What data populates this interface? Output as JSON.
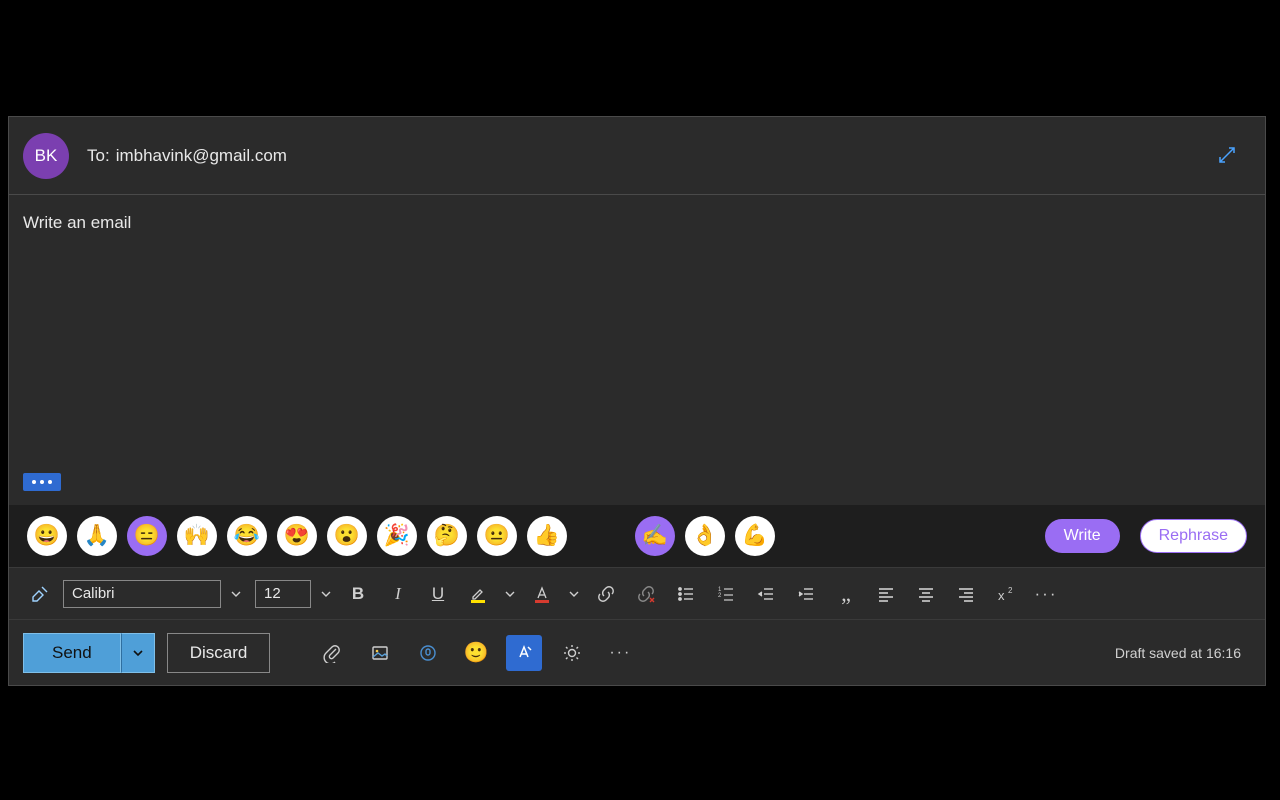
{
  "header": {
    "avatar_initials": "BK",
    "to_label": "To:",
    "to_value": "imbhavink@gmail.com"
  },
  "body": {
    "text": "Write an email"
  },
  "emoji_bar": {
    "group1": [
      "😀",
      "🙏",
      "😑",
      "🙌",
      "😂",
      "😍",
      "😮",
      "🎉",
      "🤔",
      "😐",
      "👍"
    ],
    "group2": [
      "✍️",
      "👌",
      "💪"
    ],
    "write_label": "Write",
    "rephrase_label": "Rephrase"
  },
  "format": {
    "font_name": "Calibri",
    "font_size": "12"
  },
  "actions": {
    "send_label": "Send",
    "discard_label": "Discard",
    "status": "Draft saved at 16:16"
  }
}
